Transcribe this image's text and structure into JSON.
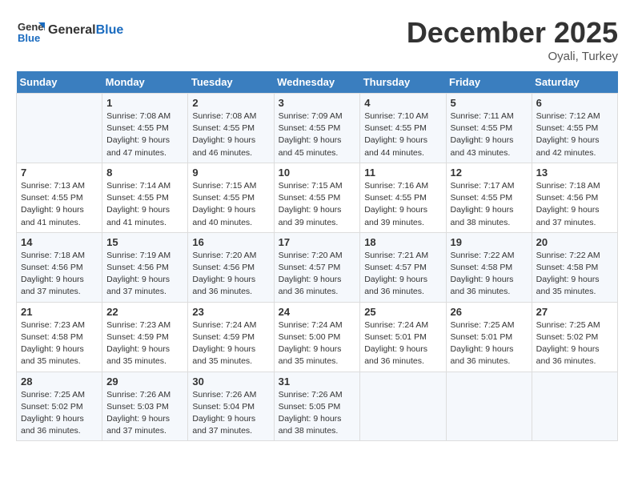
{
  "header": {
    "logo_general": "General",
    "logo_blue": "Blue",
    "month": "December 2025",
    "location": "Oyali, Turkey"
  },
  "weekdays": [
    "Sunday",
    "Monday",
    "Tuesday",
    "Wednesday",
    "Thursday",
    "Friday",
    "Saturday"
  ],
  "weeks": [
    [
      {
        "day": "",
        "info": ""
      },
      {
        "day": "1",
        "info": "Sunrise: 7:08 AM\nSunset: 4:55 PM\nDaylight: 9 hours\nand 47 minutes."
      },
      {
        "day": "2",
        "info": "Sunrise: 7:08 AM\nSunset: 4:55 PM\nDaylight: 9 hours\nand 46 minutes."
      },
      {
        "day": "3",
        "info": "Sunrise: 7:09 AM\nSunset: 4:55 PM\nDaylight: 9 hours\nand 45 minutes."
      },
      {
        "day": "4",
        "info": "Sunrise: 7:10 AM\nSunset: 4:55 PM\nDaylight: 9 hours\nand 44 minutes."
      },
      {
        "day": "5",
        "info": "Sunrise: 7:11 AM\nSunset: 4:55 PM\nDaylight: 9 hours\nand 43 minutes."
      },
      {
        "day": "6",
        "info": "Sunrise: 7:12 AM\nSunset: 4:55 PM\nDaylight: 9 hours\nand 42 minutes."
      }
    ],
    [
      {
        "day": "7",
        "info": "Sunrise: 7:13 AM\nSunset: 4:55 PM\nDaylight: 9 hours\nand 41 minutes."
      },
      {
        "day": "8",
        "info": "Sunrise: 7:14 AM\nSunset: 4:55 PM\nDaylight: 9 hours\nand 41 minutes."
      },
      {
        "day": "9",
        "info": "Sunrise: 7:15 AM\nSunset: 4:55 PM\nDaylight: 9 hours\nand 40 minutes."
      },
      {
        "day": "10",
        "info": "Sunrise: 7:15 AM\nSunset: 4:55 PM\nDaylight: 9 hours\nand 39 minutes."
      },
      {
        "day": "11",
        "info": "Sunrise: 7:16 AM\nSunset: 4:55 PM\nDaylight: 9 hours\nand 39 minutes."
      },
      {
        "day": "12",
        "info": "Sunrise: 7:17 AM\nSunset: 4:55 PM\nDaylight: 9 hours\nand 38 minutes."
      },
      {
        "day": "13",
        "info": "Sunrise: 7:18 AM\nSunset: 4:56 PM\nDaylight: 9 hours\nand 37 minutes."
      }
    ],
    [
      {
        "day": "14",
        "info": "Sunrise: 7:18 AM\nSunset: 4:56 PM\nDaylight: 9 hours\nand 37 minutes."
      },
      {
        "day": "15",
        "info": "Sunrise: 7:19 AM\nSunset: 4:56 PM\nDaylight: 9 hours\nand 37 minutes."
      },
      {
        "day": "16",
        "info": "Sunrise: 7:20 AM\nSunset: 4:56 PM\nDaylight: 9 hours\nand 36 minutes."
      },
      {
        "day": "17",
        "info": "Sunrise: 7:20 AM\nSunset: 4:57 PM\nDaylight: 9 hours\nand 36 minutes."
      },
      {
        "day": "18",
        "info": "Sunrise: 7:21 AM\nSunset: 4:57 PM\nDaylight: 9 hours\nand 36 minutes."
      },
      {
        "day": "19",
        "info": "Sunrise: 7:22 AM\nSunset: 4:58 PM\nDaylight: 9 hours\nand 36 minutes."
      },
      {
        "day": "20",
        "info": "Sunrise: 7:22 AM\nSunset: 4:58 PM\nDaylight: 9 hours\nand 35 minutes."
      }
    ],
    [
      {
        "day": "21",
        "info": "Sunrise: 7:23 AM\nSunset: 4:58 PM\nDaylight: 9 hours\nand 35 minutes."
      },
      {
        "day": "22",
        "info": "Sunrise: 7:23 AM\nSunset: 4:59 PM\nDaylight: 9 hours\nand 35 minutes."
      },
      {
        "day": "23",
        "info": "Sunrise: 7:24 AM\nSunset: 4:59 PM\nDaylight: 9 hours\nand 35 minutes."
      },
      {
        "day": "24",
        "info": "Sunrise: 7:24 AM\nSunset: 5:00 PM\nDaylight: 9 hours\nand 35 minutes."
      },
      {
        "day": "25",
        "info": "Sunrise: 7:24 AM\nSunset: 5:01 PM\nDaylight: 9 hours\nand 36 minutes."
      },
      {
        "day": "26",
        "info": "Sunrise: 7:25 AM\nSunset: 5:01 PM\nDaylight: 9 hours\nand 36 minutes."
      },
      {
        "day": "27",
        "info": "Sunrise: 7:25 AM\nSunset: 5:02 PM\nDaylight: 9 hours\nand 36 minutes."
      }
    ],
    [
      {
        "day": "28",
        "info": "Sunrise: 7:25 AM\nSunset: 5:02 PM\nDaylight: 9 hours\nand 36 minutes."
      },
      {
        "day": "29",
        "info": "Sunrise: 7:26 AM\nSunset: 5:03 PM\nDaylight: 9 hours\nand 37 minutes."
      },
      {
        "day": "30",
        "info": "Sunrise: 7:26 AM\nSunset: 5:04 PM\nDaylight: 9 hours\nand 37 minutes."
      },
      {
        "day": "31",
        "info": "Sunrise: 7:26 AM\nSunset: 5:05 PM\nDaylight: 9 hours\nand 38 minutes."
      },
      {
        "day": "",
        "info": ""
      },
      {
        "day": "",
        "info": ""
      },
      {
        "day": "",
        "info": ""
      }
    ]
  ]
}
